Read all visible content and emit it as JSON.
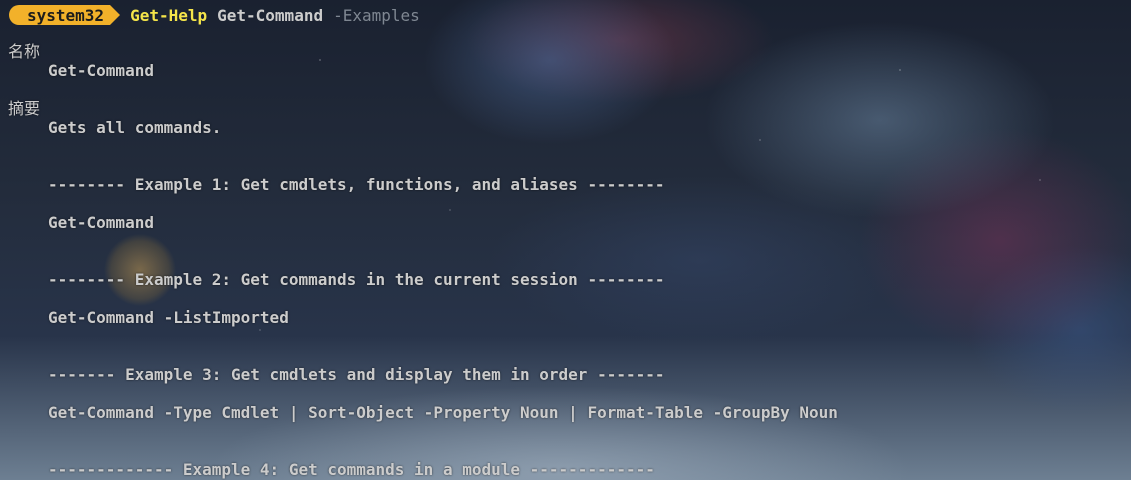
{
  "prompt": {
    "directory": "system32",
    "command": "Get-Help",
    "argument": "Get-Command",
    "parameter": "-Examples"
  },
  "help": {
    "name_heading": "名称",
    "name_value": "Get-Command",
    "synopsis_heading": "摘要",
    "synopsis_value": "Gets all commands.",
    "examples": [
      {
        "header": "-------- Example 1: Get cmdlets, functions, and aliases --------",
        "code": "Get-Command"
      },
      {
        "header": "-------- Example 2: Get commands in the current session --------",
        "code": "Get-Command -ListImported"
      },
      {
        "header": "------- Example 3: Get cmdlets and display them in order -------",
        "code": "Get-Command -Type Cmdlet | Sort-Object -Property Noun | Format-Table -GroupBy Noun"
      },
      {
        "header": "------------- Example 4: Get commands in a module -------------",
        "code": ""
      }
    ]
  },
  "colors": {
    "prompt_badge": "#f2b12a",
    "command": "#f5e54a",
    "text": "#cccccc",
    "parameter": "#7f8792"
  }
}
